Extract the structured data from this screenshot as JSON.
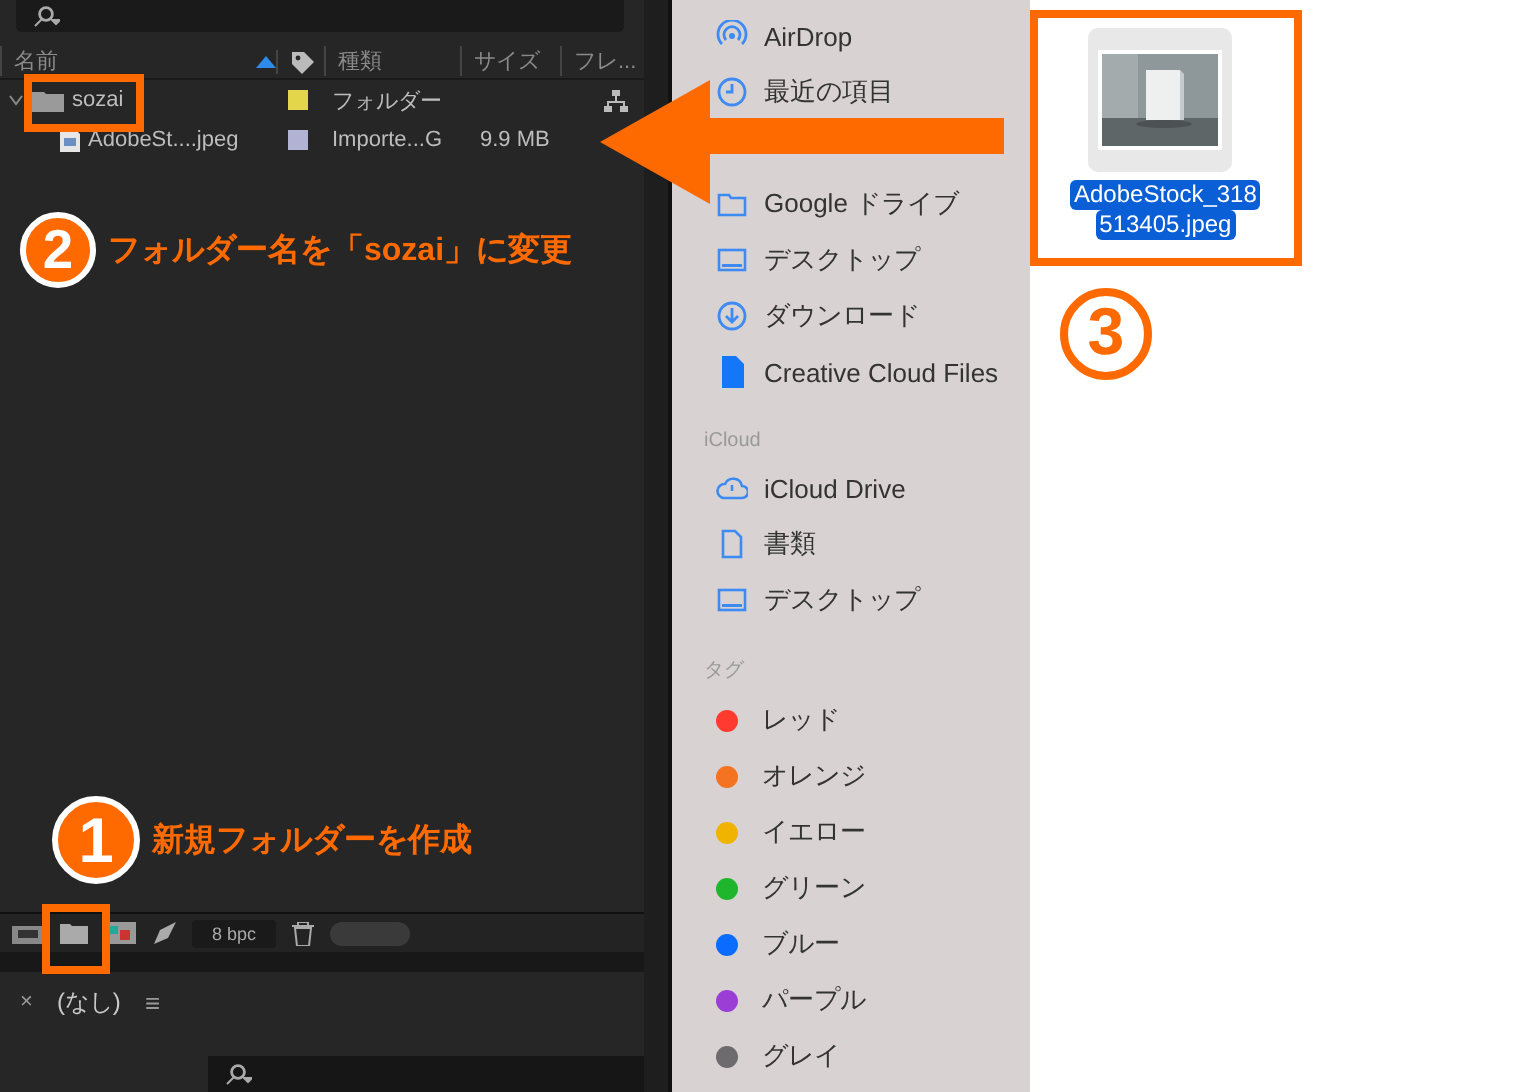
{
  "project_panel": {
    "columns": [
      "名前",
      "種類",
      "サイズ",
      "フレ..."
    ],
    "rows": [
      {
        "name": "sozai",
        "kind": "folder",
        "expanded": true,
        "color": "#e3d64a",
        "type": "フォルダー",
        "children": [
          {
            "name": "AdobeSt....jpeg",
            "kind": "file",
            "color": "#b2b2d4",
            "type": "Importe...G",
            "size": "9.9 MB"
          }
        ]
      }
    ],
    "bit_depth": "8 bpc"
  },
  "timeline_panel": {
    "close": "×",
    "tab": "(なし)",
    "menu": "≡"
  },
  "finder_sidebar": {
    "favorites": [
      {
        "label": "AirDrop",
        "kind": "airdrop"
      },
      {
        "label": "最近の項目",
        "kind": "clock"
      },
      {
        "kind": "hidden"
      },
      {
        "label": "Google ドライブ",
        "kind": "folder"
      },
      {
        "label": "デスクトップ",
        "kind": "desktop"
      },
      {
        "label": "ダウンロード",
        "kind": "download"
      },
      {
        "label": "Creative Cloud Files",
        "kind": "file"
      }
    ],
    "icloud": {
      "heading": "iCloud",
      "items": [
        {
          "label": "iCloud Drive",
          "kind": "cloud"
        },
        {
          "label": "書類",
          "kind": "document"
        },
        {
          "label": "デスクトップ",
          "kind": "desktop"
        }
      ]
    },
    "tags": {
      "heading": "タグ",
      "items": [
        {
          "label": "レッド",
          "color": "#ff3b30"
        },
        {
          "label": "オレンジ",
          "color": "#f47320"
        },
        {
          "label": "イエロー",
          "color": "#f0b400"
        },
        {
          "label": "グリーン",
          "color": "#1fb52d"
        },
        {
          "label": "ブルー",
          "color": "#0a6cff"
        },
        {
          "label": "パープル",
          "color": "#9b3ed6"
        },
        {
          "label": "グレイ",
          "color": "#6e6b6e"
        }
      ]
    }
  },
  "finder_file": {
    "name_lines": [
      "AdobeStock_318",
      "513405.jpeg"
    ],
    "selected": true
  },
  "annotations": [
    {
      "number": "2",
      "kind": "filled",
      "text": "フォルダー名を「sozai」に変更"
    },
    {
      "number": "1",
      "kind": "filled",
      "text": "新規フォルダーを作成"
    },
    {
      "number": "3",
      "kind": "outline"
    }
  ]
}
